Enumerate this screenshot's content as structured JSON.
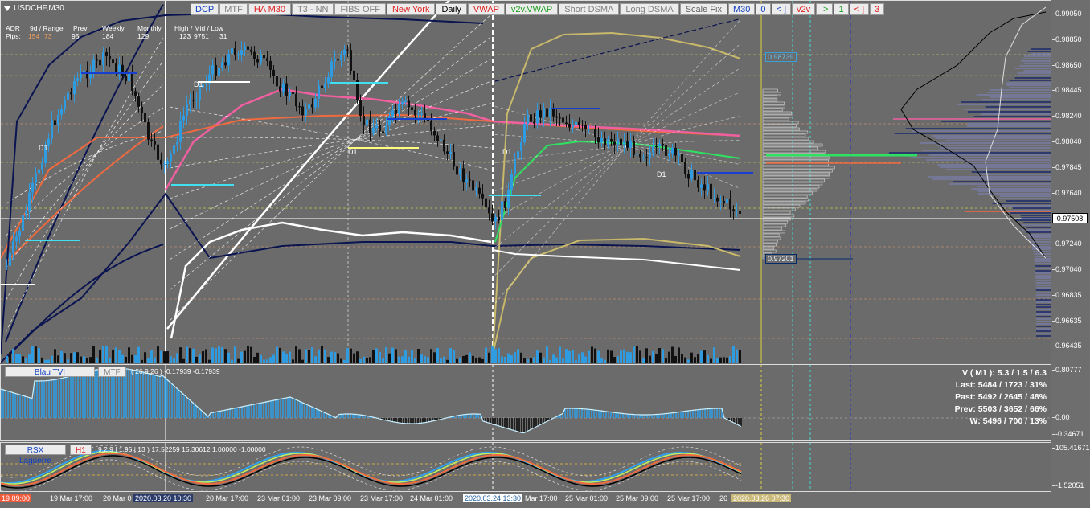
{
  "window": {
    "symbol": "USDCHF,M30"
  },
  "toolbar": {
    "buttons": [
      {
        "label": "DCP",
        "color": "#1040c0"
      },
      {
        "label": "MTF",
        "color": "#808080"
      },
      {
        "label": "HA M30",
        "color": "#e02020"
      },
      {
        "label": "T3 - NN",
        "color": "#808080"
      },
      {
        "label": "FIBS OFF",
        "color": "#808080"
      },
      {
        "label": "New York",
        "color": "#e02020"
      },
      {
        "label": "Daily",
        "color": "#000000"
      },
      {
        "label": "VWAP",
        "color": "#e02020"
      },
      {
        "label": "v2v.VWAP",
        "color": "#20a020"
      },
      {
        "label": "Short DSMA",
        "color": "#808080"
      },
      {
        "label": "Long DSMA",
        "color": "#808080"
      },
      {
        "label": "Scale Fix",
        "color": "#606060"
      },
      {
        "label": "M30",
        "color": "#1040c0"
      },
      {
        "label": "0",
        "color": "#1040c0"
      },
      {
        "label": "< ]",
        "color": "#1040c0"
      },
      {
        "label": "v2v",
        "color": "#e02020"
      },
      {
        "label": "|>",
        "color": "#20a020"
      },
      {
        "label": "1",
        "color": "#20a020"
      },
      {
        "label": "< ]",
        "color": "#e02020"
      },
      {
        "label": "3",
        "color": "#e02020"
      }
    ]
  },
  "adr": {
    "headers": [
      "ADR",
      "9d / Range",
      "Prev",
      "Weekly",
      "Monthly",
      "High / Mid / Low"
    ],
    "pips_label": "Pips:",
    "pips_values": [
      "154",
      "73",
      "95",
      "184",
      "129",
      "123",
      "9751",
      "31"
    ]
  },
  "d1_labels": [
    "D1",
    "D1",
    "D1",
    "D1",
    "D1"
  ],
  "price_scale": [
    "0.99050",
    "0.98850",
    "0.98650",
    "0.98445",
    "0.98240",
    "0.98040",
    "0.97845",
    "0.97640",
    "0.97440",
    "0.97240",
    "0.97040",
    "0.96835",
    "0.96635",
    "0.96435"
  ],
  "current_price": "0.97508",
  "level_boxes": {
    "upper": "0.98739",
    "lower": "0.97201"
  },
  "tvi": {
    "name": "Blau TVI",
    "tf": "MTF",
    "params": "( 26,9,26 ) -0.17939 -0.17939",
    "scale": [
      "0.80777",
      "0.00",
      "-0.34671"
    ],
    "stats": [
      "V ( M1 ): 5.3 / 1.5 / 6.3",
      "Last: 5484 / 1723 / 31%",
      "Past: 5492 / 2645 / 48%",
      "Prev: 5503 / 3652 / 66%",
      "W: 5496 / 700 / 13%"
    ]
  },
  "rsx": {
    "name": "RSX Laguerre",
    "tf": "H1",
    "params": "9,2,9 | 1.96 | 13 ) 17.52259 15.30612 1.00000 -1.00000",
    "scale": [
      "105.41671",
      "-1.52051"
    ]
  },
  "time_axis": [
    {
      "label": "19 09:00",
      "style": "hl2"
    },
    {
      "label": "19 Mar 17:00",
      "style": ""
    },
    {
      "label": "20 Mar 0",
      "style": ""
    },
    {
      "label": "2020.03.20 10:30",
      "style": "hl4"
    },
    {
      "label": "20 Mar 17:00",
      "style": ""
    },
    {
      "label": "23 Mar 01:00",
      "style": ""
    },
    {
      "label": "23 Mar 09:00",
      "style": ""
    },
    {
      "label": "23 Mar 17:00",
      "style": ""
    },
    {
      "label": "24 Mar 01:00",
      "style": ""
    },
    {
      "label": "2020.03.24 13:30",
      "style": "hl"
    },
    {
      "label": "Mar 17:00",
      "style": ""
    },
    {
      "label": "25 Mar 01:00",
      "style": ""
    },
    {
      "label": "25 Mar 09:00",
      "style": ""
    },
    {
      "label": "25 Mar 17:00",
      "style": ""
    },
    {
      "label": "26",
      "style": ""
    },
    {
      "label": "2020.03.26 07:30",
      "style": "hl3"
    }
  ],
  "colors": {
    "background": "#6b6b6b",
    "bull_candle": "#2f9be0",
    "bear_candle": "#111111",
    "vwap_pink": "#f060a0",
    "vwap_orange": "#f06a40",
    "green_line": "#30e060",
    "navy_band": "#0a1450",
    "khaki_band": "#c8b86a",
    "white_band": "#ffffff"
  }
}
